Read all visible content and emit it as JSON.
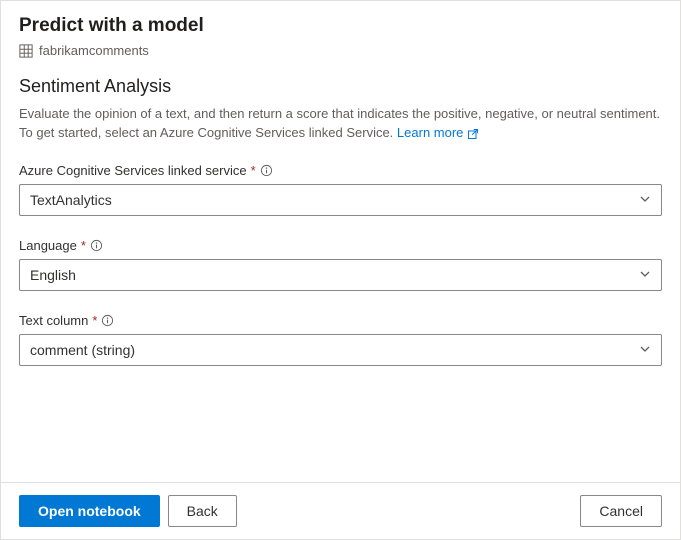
{
  "header": {
    "title": "Predict with a model",
    "resource": "fabrikamcomments"
  },
  "section": {
    "title": "Sentiment Analysis",
    "description": "Evaluate the opinion of a text, and then return a score that indicates the positive, negative, or neutral sentiment. To get started, select an Azure Cognitive Services linked Service. ",
    "learn_more": "Learn more"
  },
  "fields": {
    "linked_service": {
      "label": "Azure Cognitive Services linked service",
      "value": "TextAnalytics"
    },
    "language": {
      "label": "Language",
      "value": "English"
    },
    "text_column": {
      "label": "Text column",
      "value": "comment (string)"
    }
  },
  "footer": {
    "open_notebook": "Open notebook",
    "back": "Back",
    "cancel": "Cancel"
  }
}
